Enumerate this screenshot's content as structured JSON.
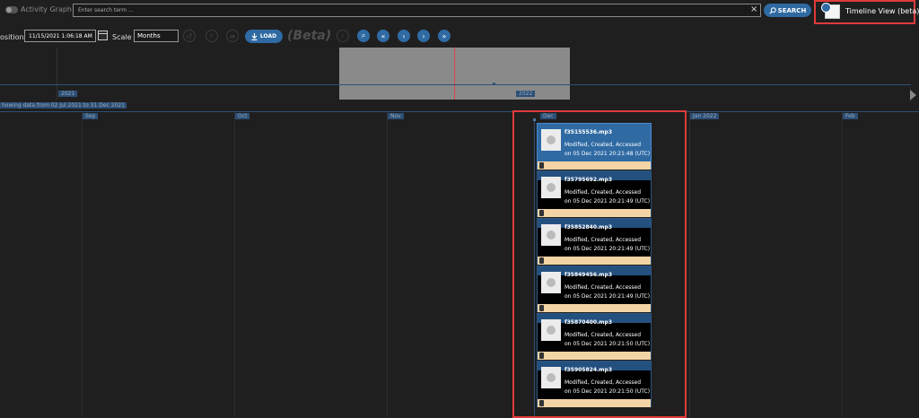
{
  "topbar": {
    "activity_graph_label": "Activity Graph",
    "search_placeholder": "Enter search term ...",
    "clear_icon": "×",
    "search_label": "SEARCH",
    "timeline_view_label": "Timeline View (beta)"
  },
  "toolbar": {
    "position_label": "osition",
    "position_value": "11/15/2021 1:06:18 AM",
    "scale_label": "Scale",
    "scale_value": "Months",
    "load_label": "LOAD",
    "beta_label": "(Beta)",
    "nav_icons": [
      "undo-icon",
      "zoom-reset-icon",
      "list-icon",
      "zoom-out-icon",
      "zoom-in-icon",
      "first-page-icon",
      "prev-icon",
      "next-icon",
      "last-page-icon"
    ]
  },
  "overview": {
    "year_left": "2021",
    "year_right": "2022",
    "showing_text": "howing data from 02 Jul 2021 to 31 Dec 2021"
  },
  "timeline": {
    "months": [
      {
        "label": "Sep"
      },
      {
        "label": "Oct"
      },
      {
        "label": "Nov"
      },
      {
        "label": "Dec"
      },
      {
        "label": "Jan 2022"
      },
      {
        "label": "Feb"
      }
    ]
  },
  "events": [
    {
      "file": "f35155536.mp3",
      "desc": "Modified, Created, Accessed",
      "time": "on 05 Dec 2021 20:21:48 (UTC)",
      "selected": true
    },
    {
      "file": "f35795692.mp3",
      "desc": "Modified, Created, Accessed",
      "time": "on 05 Dec 2021 20:21:49 (UTC)",
      "selected": false
    },
    {
      "file": "f35852840.mp3",
      "desc": "Modified, Created, Accessed",
      "time": "on 05 Dec 2021 20:21:49 (UTC)",
      "selected": false
    },
    {
      "file": "f35849456.mp3",
      "desc": "Modified, Created, Accessed",
      "time": "on 05 Dec 2021 20:21:49 (UTC)",
      "selected": false
    },
    {
      "file": "f35870400.mp3",
      "desc": "Modified, Created, Accessed",
      "time": "on 05 Dec 2021 20:21:50 (UTC)",
      "selected": false
    },
    {
      "file": "f35905824.mp3",
      "desc": "Modified, Created, Accessed",
      "time": "on 05 Dec 2021 20:21:50 (UTC)",
      "selected": false
    }
  ],
  "colors": {
    "accent": "#2f6aa3",
    "highlight_border": "#e03a3a",
    "card_footer": "#f3d5a5"
  }
}
